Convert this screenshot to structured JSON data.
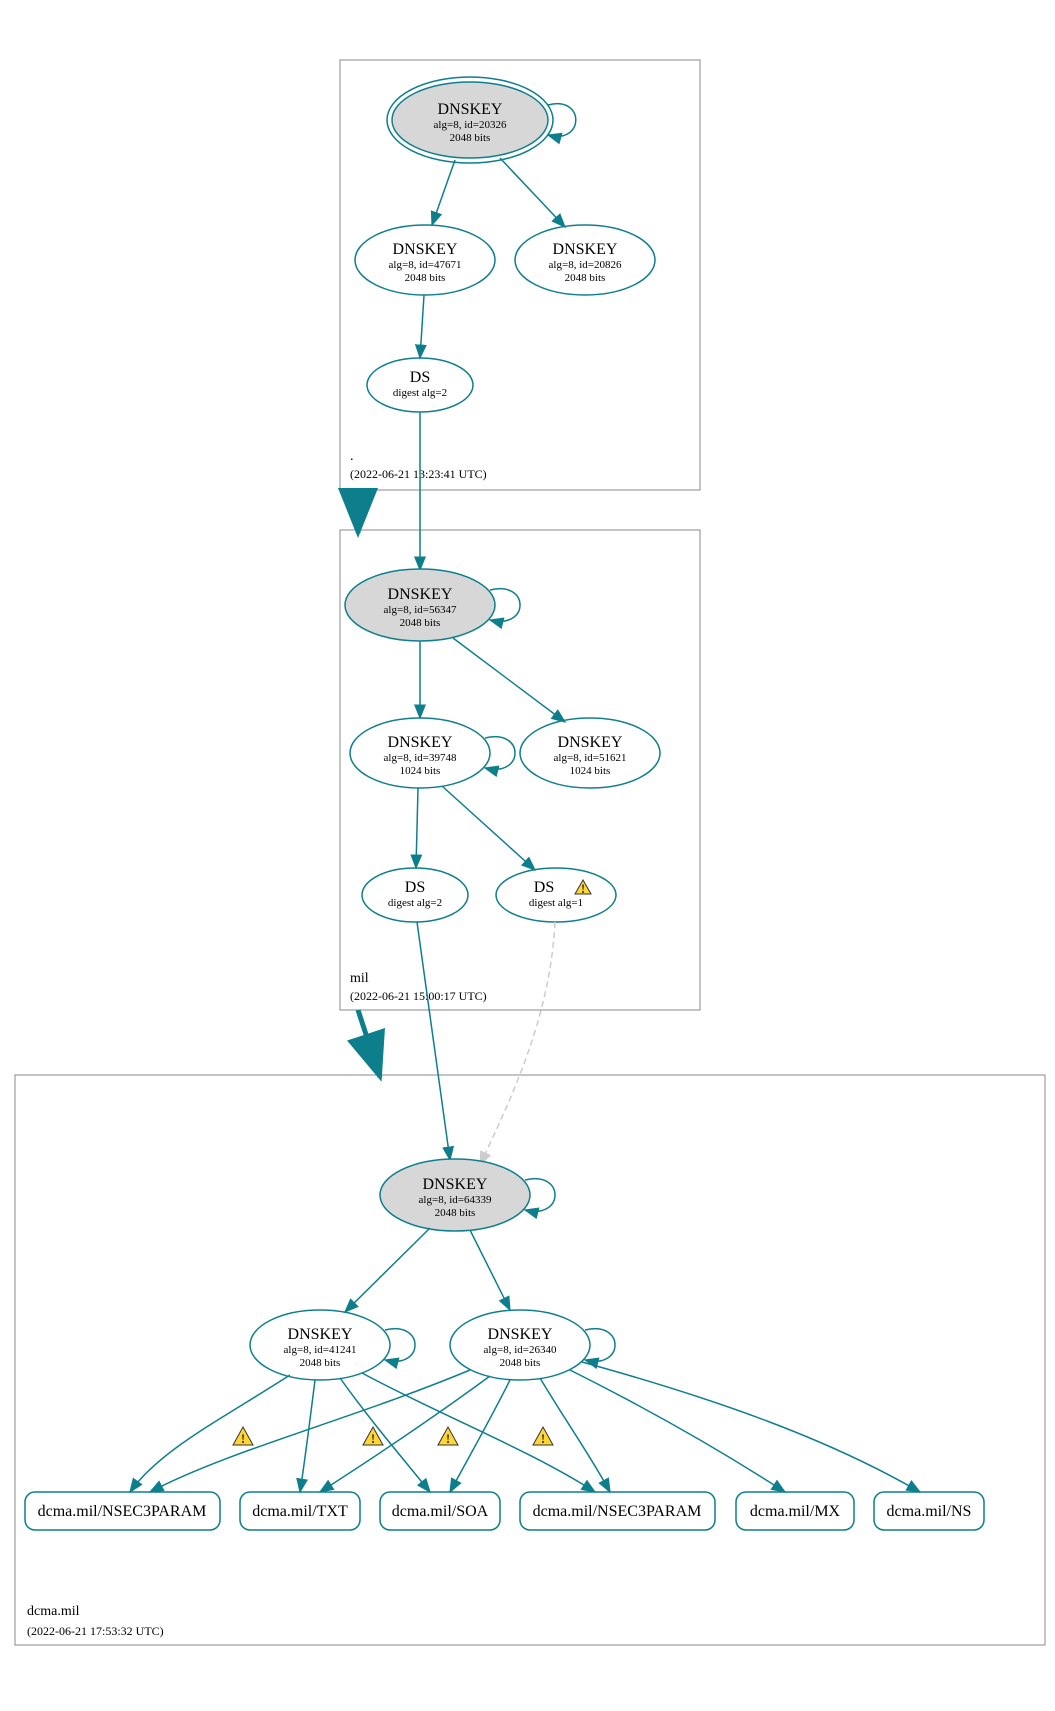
{
  "zones": {
    "root": {
      "label": ".",
      "timestamp": "(2022-06-21 13:23:41 UTC)",
      "nodes": {
        "ksk": {
          "title": "DNSKEY",
          "line1": "alg=8, id=20326",
          "line2": "2048 bits"
        },
        "zsk": {
          "title": "DNSKEY",
          "line1": "alg=8, id=47671",
          "line2": "2048 bits"
        },
        "standby": {
          "title": "DNSKEY",
          "line1": "alg=8, id=20826",
          "line2": "2048 bits"
        },
        "ds": {
          "title": "DS",
          "line1": "digest alg=2"
        }
      }
    },
    "mil": {
      "label": "mil",
      "timestamp": "(2022-06-21 15:00:17 UTC)",
      "nodes": {
        "ksk": {
          "title": "DNSKEY",
          "line1": "alg=8, id=56347",
          "line2": "2048 bits"
        },
        "zsk": {
          "title": "DNSKEY",
          "line1": "alg=8, id=39748",
          "line2": "1024 bits"
        },
        "standby": {
          "title": "DNSKEY",
          "line1": "alg=8, id=51621",
          "line2": "1024 bits"
        },
        "ds1": {
          "title": "DS",
          "line1": "digest alg=2"
        },
        "ds2": {
          "title": "DS",
          "line1": "digest alg=1"
        }
      }
    },
    "dcma": {
      "label": "dcma.mil",
      "timestamp": "(2022-06-21 17:53:32 UTC)",
      "nodes": {
        "ksk": {
          "title": "DNSKEY",
          "line1": "alg=8, id=64339",
          "line2": "2048 bits"
        },
        "zsk1": {
          "title": "DNSKEY",
          "line1": "alg=8, id=41241",
          "line2": "2048 bits"
        },
        "zsk2": {
          "title": "DNSKEY",
          "line1": "alg=8, id=26340",
          "line2": "2048 bits"
        }
      },
      "records": {
        "r1": "dcma.mil/NSEC3PARAM",
        "r2": "dcma.mil/TXT",
        "r3": "dcma.mil/SOA",
        "r4": "dcma.mil/NSEC3PARAM",
        "r5": "dcma.mil/MX",
        "r6": "dcma.mil/NS"
      }
    }
  }
}
